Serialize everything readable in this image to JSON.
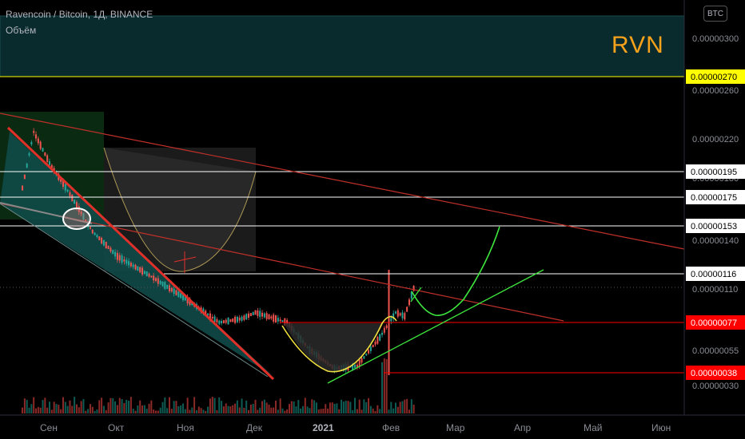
{
  "header": {
    "symbol_line": "Ravencoin / Bitcoin, 1Д, BINANCE",
    "volume_label": "Объём",
    "currency_badge": "BTC"
  },
  "annotation_text": "RVN",
  "colors": {
    "background": "#000000",
    "up_candle": "#26a69a",
    "down_candle": "#ef5350",
    "volume_up": "#0f5c55",
    "volume_down": "#8a2a28",
    "resistance_line": "#ffffff",
    "support_line": "#ff0000",
    "top_line": "#ffff00",
    "trend_red": "#e0302a",
    "cup_yellow": "#f0e040",
    "projection_green": "#3ee83e",
    "label_text": "#ffffff"
  },
  "chart_data": {
    "type": "candlestick",
    "pair": "Ravencoin / Bitcoin",
    "exchange": "BINANCE",
    "interval": "1Д",
    "x_tick_labels": [
      "Сен",
      "Окт",
      "Ноя",
      "Дек",
      "2021",
      "Фев",
      "Мар",
      "Апр",
      "Май",
      "Июн"
    ],
    "y_tick_labels": [
      "0.00000300",
      "0.00000260",
      "0.00000220",
      "0.00000180",
      "0.00000140",
      "0.00000110",
      "0.00000055",
      "0.00000030"
    ],
    "horizontal_levels": [
      {
        "value": "0.00000270",
        "color": "#ffff00",
        "label_bg": "#ffff00",
        "label_color": "#000000"
      },
      {
        "value": "0.00000195",
        "color": "#ffffff",
        "label_bg": "#ffffff",
        "label_color": "#000000"
      },
      {
        "value": "0.00000175",
        "color": "#ffffff",
        "label_bg": "#ffffff",
        "label_color": "#000000"
      },
      {
        "value": "0.00000153",
        "color": "#ffffff",
        "label_bg": "#ffffff",
        "label_color": "#000000"
      },
      {
        "value": "0.00000116",
        "color": "#ffffff",
        "label_bg": "#ffffff",
        "label_color": "#000000"
      },
      {
        "value": "0.00000077",
        "color": "#ff0000",
        "label_bg": "#ff0000",
        "label_color": "#ffffff"
      },
      {
        "value": "0.00000038",
        "color": "#ff0000",
        "label_bg": "#ff0000",
        "label_color": "#ffffff"
      }
    ],
    "price_path": [
      {
        "date": "2020-08-20",
        "close": 1.85e-06
      },
      {
        "date": "2020-08-25",
        "close": 2.3e-06
      },
      {
        "date": "2020-09-01",
        "close": 2.05e-06
      },
      {
        "date": "2020-09-10",
        "close": 1.8e-06
      },
      {
        "date": "2020-09-20",
        "close": 1.5e-06
      },
      {
        "date": "2020-10-01",
        "close": 1.3e-06
      },
      {
        "date": "2020-10-15",
        "close": 1.15e-06
      },
      {
        "date": "2020-11-01",
        "close": 9.5e-07
      },
      {
        "date": "2020-11-15",
        "close": 7.7e-07
      },
      {
        "date": "2020-11-25",
        "close": 8e-07
      },
      {
        "date": "2020-12-01",
        "close": 8.5e-07
      },
      {
        "date": "2020-12-15",
        "close": 7.7e-07
      },
      {
        "date": "2020-12-25",
        "close": 5.5e-07
      },
      {
        "date": "2021-01-05",
        "close": 4e-07
      },
      {
        "date": "2021-01-15",
        "close": 4.2e-07
      },
      {
        "date": "2021-01-25",
        "close": 6.5e-07
      },
      {
        "date": "2021-02-01",
        "close": 8.5e-07
      },
      {
        "date": "2021-02-05",
        "close": 8.2e-07
      },
      {
        "date": "2021-02-10",
        "close": 1.1e-06
      }
    ]
  }
}
